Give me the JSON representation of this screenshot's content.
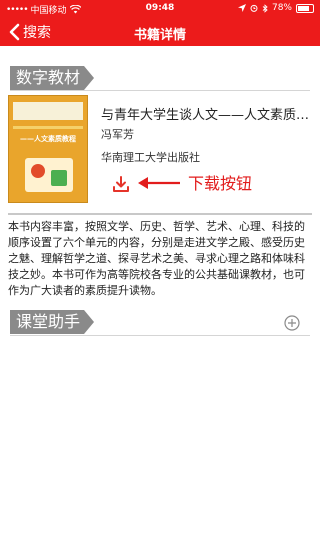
{
  "status_bar": {
    "signal": "•••••",
    "carrier": "中国移动",
    "time": "09:48",
    "battery": "78%",
    "battery_level": 0.78
  },
  "nav": {
    "back_label": "搜索",
    "title": "书籍详情"
  },
  "sections": {
    "digital_materials": "数字教材",
    "class_assistant": "课堂助手"
  },
  "book": {
    "title": "与青年大学生谈人文——人文素质…",
    "author": "冯军芳",
    "publisher": "华南理工大学出版社",
    "cover_title": "——人文素质教程"
  },
  "annotation": {
    "label": "下载按钮"
  },
  "description": "本书内容丰富，按照文学、历史、哲学、艺术、心理、科技的顺序设置了六个单元的内容，分别是走进文学之殿、感受历史之魅、理解哲学之道、探寻艺术之美、寻求心理之路和体味科技之妙。本书可作为高等院校各专业的公共基础课教材，也可作为广大读者的素质提升读物。",
  "colors": {
    "primary": "#ec1b1b",
    "tag_gray": "#8a8a8a",
    "annotation_red": "#e21c1c"
  },
  "icons": {
    "back": "chevron-left-icon",
    "download": "download-icon",
    "add": "plus-circle-icon",
    "arrow": "arrow-left-icon"
  }
}
